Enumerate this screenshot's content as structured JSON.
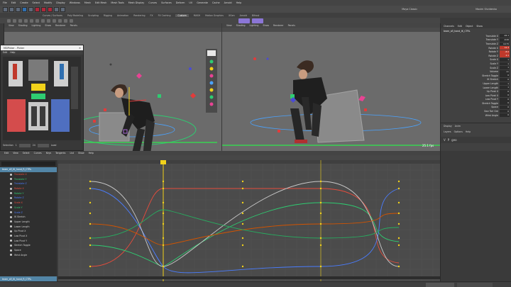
{
  "menubar": {
    "items": [
      "File",
      "Edit",
      "Create",
      "Select",
      "Modify",
      "Display",
      "Windows",
      "Mesh",
      "Edit Mesh",
      "Mesh Tools",
      "Mesh Display",
      "Curves",
      "Surfaces",
      "Deform",
      "UV",
      "Generate",
      "Cache",
      "Arnold",
      "Help"
    ],
    "workspace": "Maya Classic",
    "user": "Maxim Shvidenko"
  },
  "shelf_tabs": [
    "Curves / Surfaces",
    "Poly Modeling",
    "Sculpting",
    "Rigging",
    "Animation",
    "Rendering",
    "FX",
    "FX Caching",
    "Custom",
    "MASH",
    "Motion Graphics",
    "XGen",
    "Arnold",
    "Bifrost"
  ],
  "viewport_left": {
    "menu": [
      "View",
      "Shading",
      "Lighting",
      "Show",
      "Renderer",
      "Panels"
    ]
  },
  "viewport_right": {
    "menu": [
      "View",
      "Shading",
      "Lighting",
      "Show",
      "Renderer",
      "Panels"
    ],
    "fps": "25.1 fps"
  },
  "picker": {
    "title": "MGPicker - Picker",
    "menu": [
      "Edit",
      "Help"
    ],
    "footer_label": "Selection",
    "footer_start": "1",
    "footer_mid": "24",
    "footer_end": "Load"
  },
  "channel_box": {
    "tabs": [
      "Channels",
      "Edit",
      "Object",
      "Show"
    ],
    "node_name": "team_sfl_hand_IK_CTRL",
    "channels": [
      {
        "label": "Translate X",
        "value": "-42.1",
        "hl": false
      },
      {
        "label": "Translate Y",
        "value": "-9.26",
        "hl": false
      },
      {
        "label": "Translate Z",
        "value": "10.75",
        "hl": false
      },
      {
        "label": "Rotate X",
        "value": "12.3",
        "hl": true
      },
      {
        "label": "Rotate Y",
        "value": "-8.0",
        "hl": true
      },
      {
        "label": "Rotate Z",
        "value": "4.1",
        "hl": true
      },
      {
        "label": "Scale X",
        "value": "1",
        "hl": false
      },
      {
        "label": "Scale Y",
        "value": "1",
        "hl": false
      },
      {
        "label": "Scale Z",
        "value": "1",
        "hl": false
      },
      {
        "label": "Volume",
        "value": "on",
        "hl": false
      },
      {
        "label": "Stretch Toggle",
        "value": "0",
        "hl": false
      },
      {
        "label": "IK Stretch",
        "value": "0",
        "hl": false
      },
      {
        "label": "Upper Length",
        "value": "1",
        "hl": false
      },
      {
        "label": "Lower Length",
        "value": "1",
        "hl": false
      },
      {
        "label": "Up Pivot X",
        "value": "0",
        "hl": false
      },
      {
        "label": "Low Pivot X",
        "value": "0",
        "hl": false
      },
      {
        "label": "Low Pivot Y",
        "value": "0",
        "hl": false
      },
      {
        "label": "Stretch Toggle",
        "value": "0",
        "hl": false
      },
      {
        "label": "Space",
        "value": "0",
        "hl": false
      },
      {
        "label": "Swv Torl Gre",
        "value": "0",
        "hl": false
      },
      {
        "label": "Wrist Angle",
        "value": "0",
        "hl": false
      }
    ]
  },
  "layer_editor": {
    "tabs": [
      "Display",
      "Anim"
    ],
    "submenu": [
      "Layers",
      "Options",
      "Help"
    ],
    "layer_name": "geo"
  },
  "graph_editor": {
    "menu": [
      "Edit",
      "View",
      "Select",
      "Curves",
      "Keys",
      "Tangents",
      "List",
      "Show",
      "Help"
    ],
    "selected_node": "team_sfl_IK_hand_R_CTRL",
    "curves": [
      "Translate X",
      "Translate Y",
      "Translate Z",
      "Rotate X",
      "Rotate Y",
      "Rotate Z",
      "Scale X",
      "Scale Y",
      "Scale Z",
      "IK Stretch",
      "Upper Length",
      "Lower Length",
      "Up Pivot X",
      "Low Pivot X",
      "Low Pivot Y",
      "Stretch Toggle",
      "Space",
      "Wrist Angle"
    ],
    "bottom_node": "team_sfl_IK_hand_R_CTRL"
  },
  "colors": {
    "accent": "#5285a6",
    "keyline": "#f2d21a",
    "viewport": "#6b6b6b"
  }
}
